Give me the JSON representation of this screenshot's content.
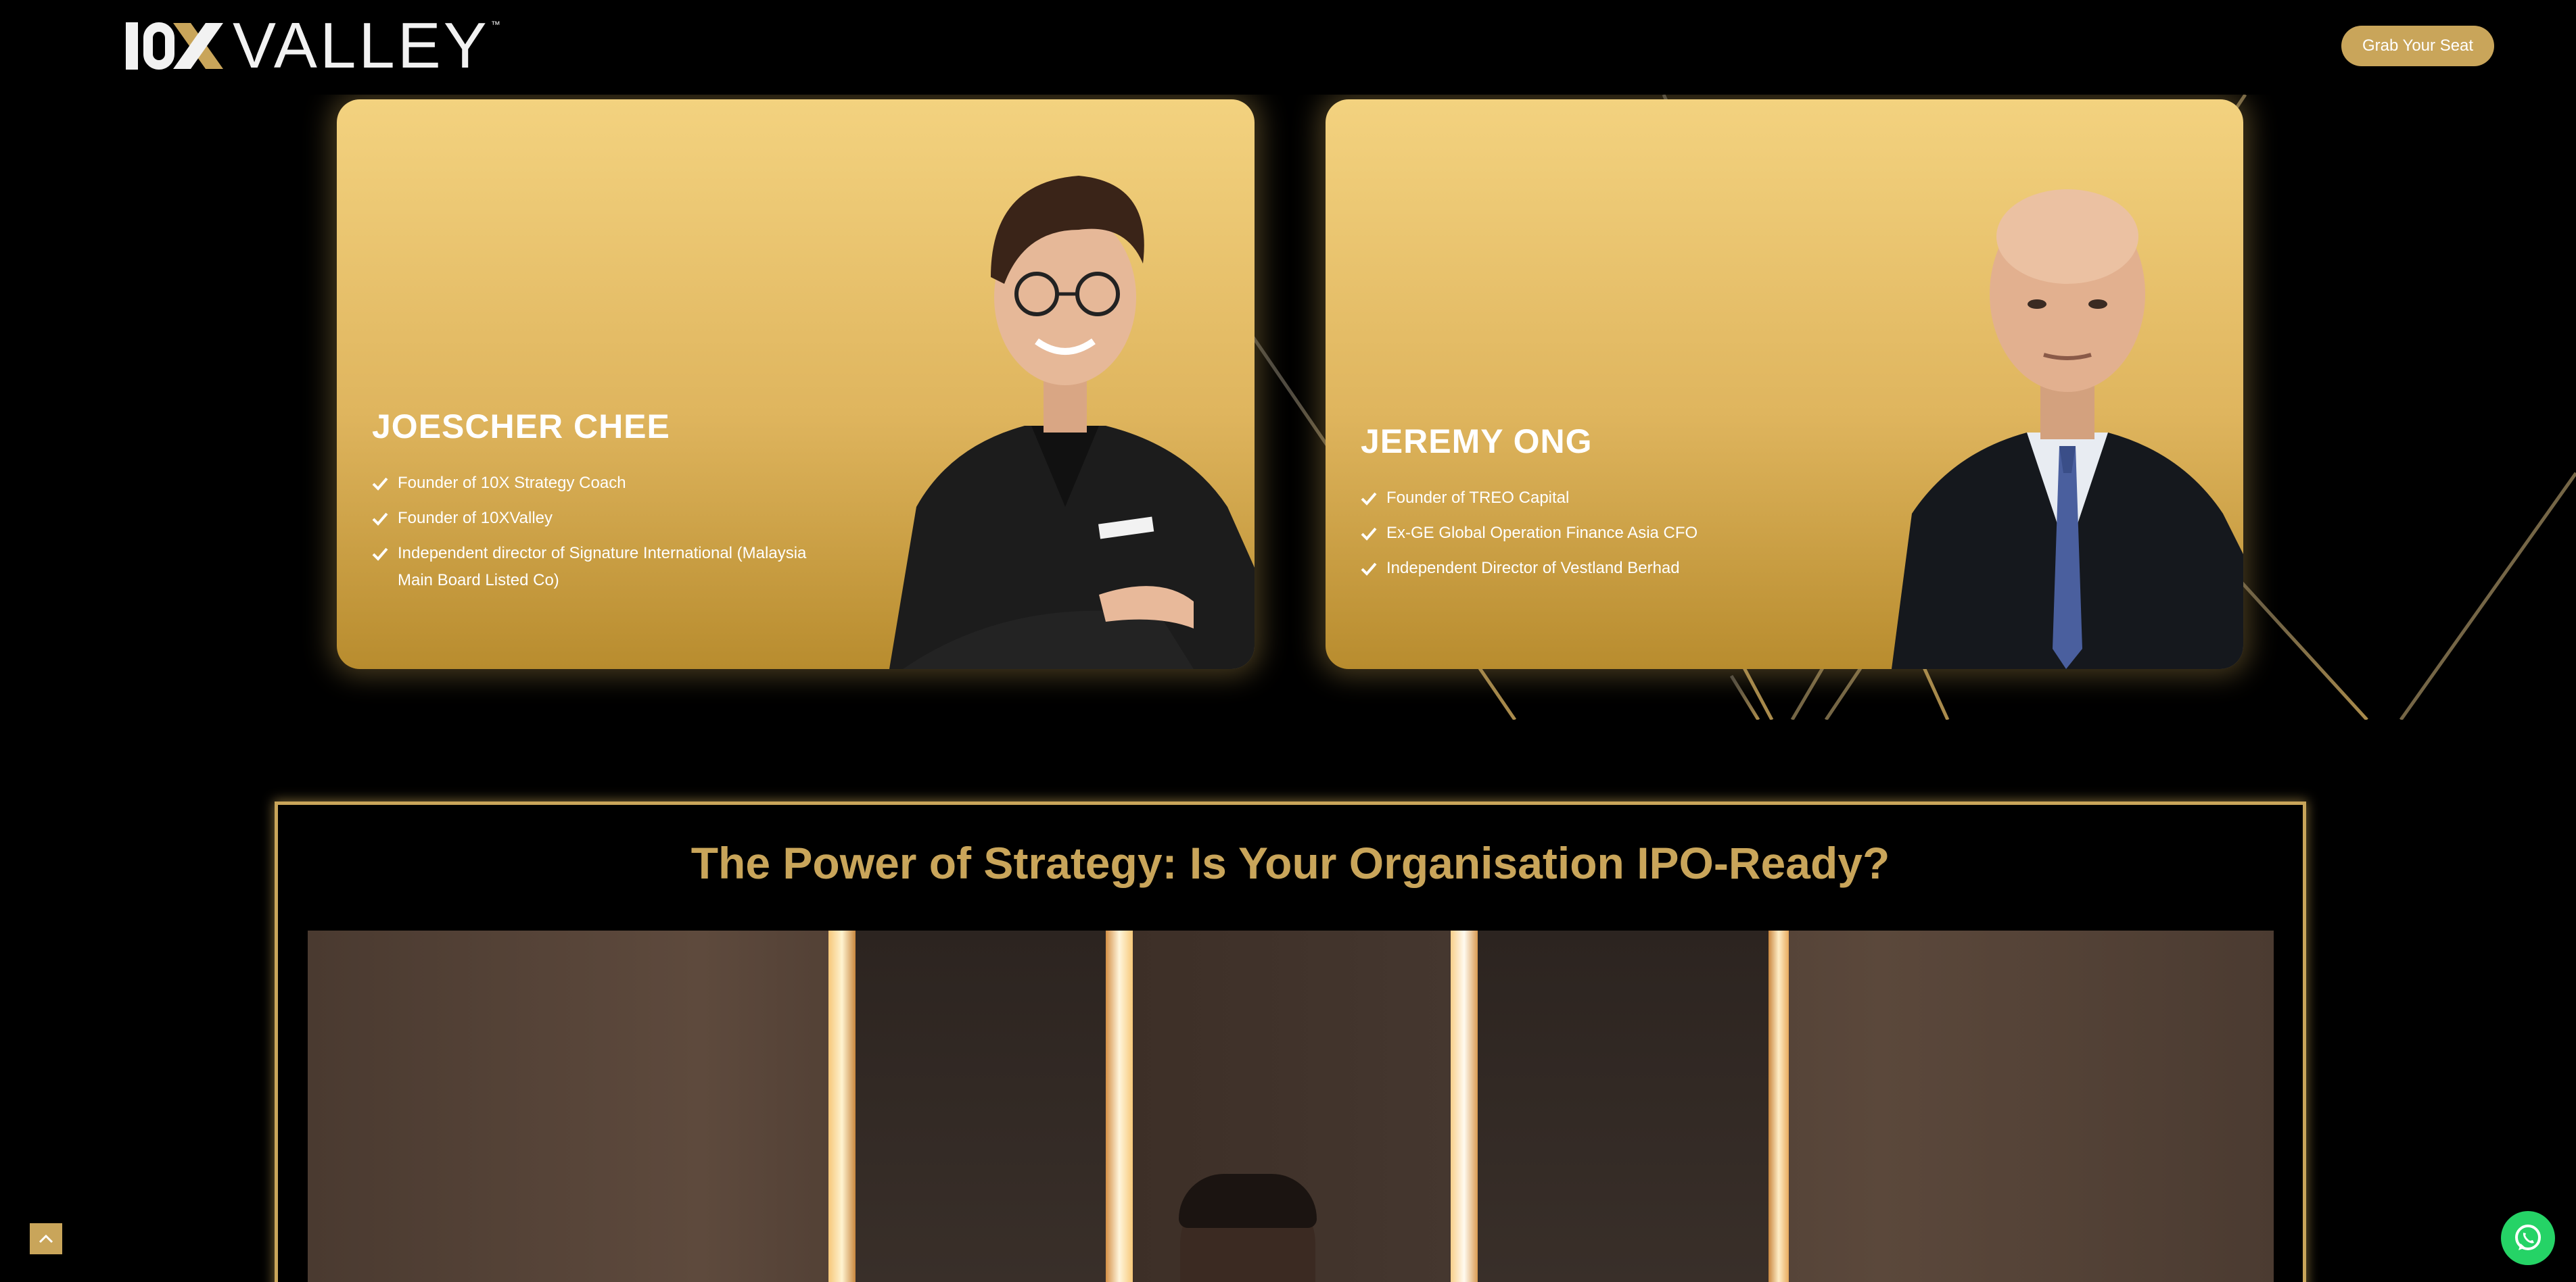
{
  "header": {
    "logo_text": "VALLEY",
    "logo_trademark": "™",
    "cta_label": "Grab Your Seat"
  },
  "speakers": [
    {
      "name": "JOESCHER CHEE",
      "points": [
        "Founder of 10X Strategy Coach",
        "Founder of 10XValley",
        "Independent director of Signature International (Malaysia Main Board Listed Co)"
      ]
    },
    {
      "name": "JEREMY ONG",
      "points": [
        "Founder of TREO Capital",
        "Ex-GE Global Operation Finance Asia CFO",
        "Independent Director of Vestland Berhad"
      ]
    }
  ],
  "video_section": {
    "title": "The Power of Strategy: Is Your Organisation IPO-Ready?"
  },
  "colors": {
    "accent_gold": "#c9a55a",
    "card_gold_top": "#f3d27f",
    "card_gold_bottom": "#b88c2e",
    "whatsapp_green": "#25d366"
  },
  "icons": {
    "check": "check-icon",
    "back_to_top": "chevron-up-icon",
    "whatsapp": "whatsapp-icon"
  }
}
